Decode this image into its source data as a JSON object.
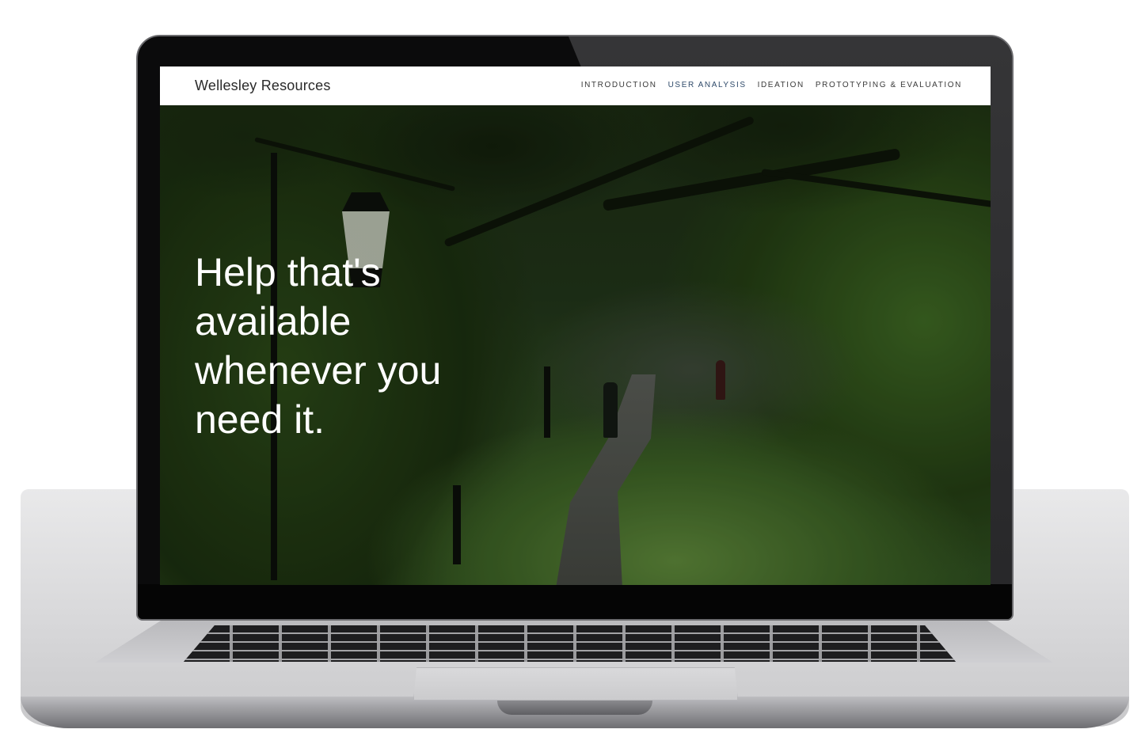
{
  "site": {
    "brand": "Wellesley Resources"
  },
  "nav": {
    "items": [
      {
        "label": "INTRODUCTION",
        "active": false
      },
      {
        "label": "USER ANALYSIS",
        "active": true
      },
      {
        "label": "IDEATION",
        "active": false
      },
      {
        "label": "PROTOTYPING & EVALUATION",
        "active": false
      }
    ]
  },
  "hero": {
    "headline": "Help that's available whenever you need it.",
    "image": "park-path-with-lamp-posts-image"
  },
  "colors": {
    "nav_active": "#2f4a6a",
    "nav_text": "#3a3a3a",
    "headline_text": "#ffffff"
  }
}
